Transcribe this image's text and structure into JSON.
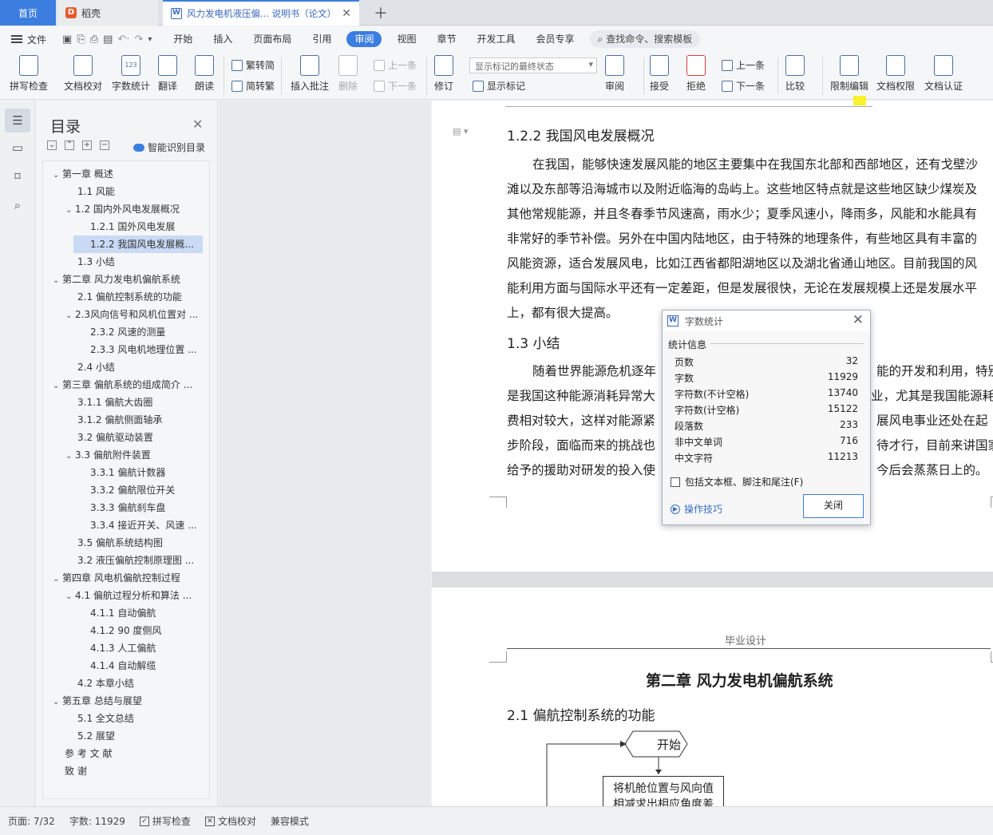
{
  "tabs": {
    "home": "首页",
    "daoke": "稻壳",
    "doc": "风力发电机液压偏... 说明书（论文）"
  },
  "menubar": {
    "file": "文件",
    "items": [
      "开始",
      "插入",
      "页面布局",
      "引用",
      "审阅",
      "视图",
      "章节",
      "开发工具",
      "会员专享"
    ],
    "active": "审阅",
    "search": "查找命令、搜索模板"
  },
  "ribbon": {
    "spell": "拼写检查",
    "proof": "文档校对",
    "wordcount": "字数统计",
    "translate": "翻译",
    "read": "朗读",
    "to_trad": "繁转简",
    "to_simp": "简转繁",
    "insert_comment": "插入批注",
    "delete": "删除",
    "prev": "上一条",
    "next": "下一条",
    "revise": "修订",
    "markup_state": "显示标记的最终状态",
    "show_markup": "显示标记",
    "review": "审阅",
    "accept": "接受",
    "reject": "拒绝",
    "prev2": "上一条",
    "next2": "下一条",
    "compare": "比较",
    "restrict": "限制编辑",
    "rights": "文档权限",
    "certify": "文档认证"
  },
  "toc": {
    "title": "目录",
    "smart": "智能识别目录",
    "items": [
      "第一章  概述",
      "1.1  风能",
      "1.2  国内外风电发展概况",
      "1.2.1  国外风电发展",
      "1.2.2  我国风电发展概...",
      "1.3  小结",
      "第二章  风力发电机偏航系统",
      "2.1 偏航控制系统的功能",
      "2.3风向信号和风机位置对 ...",
      "2.3.2 风速的测量",
      "2.3.3  风电机地理位置 ...",
      "2.4 小结",
      "第三章  偏航系统的组成简介 ...",
      "3.1.1 偏航大齿圈",
      "3.1.2 偏航侧面轴承",
      "3.2 偏航驱动装置",
      "3.3 偏航附件装置",
      "3.3.1 偏航计数器",
      "3.3.2 偏航限位开关",
      "3.3.3 偏航刹车盘",
      "3.3.4 接近开关、风速 ...",
      "3.5  偏航系统结构图",
      "3.2 液压偏航控制原理图 ...",
      "第四章  风电机偏航控制过程",
      "4.1 偏航过程分析和算法 ...",
      "4.1.1 自动偏航",
      "4.1.2 90 度侧风",
      "4.1.3 人工偏航",
      "4.1.4 自动解缆",
      "4.2 本章小结",
      "第五章  总结与展望",
      "5.1  全文总结",
      "5.2  展望",
      "参 考 文 献",
      "致  谢"
    ]
  },
  "page1": {
    "heading_122": "1.2.2  我国风电发展概况",
    "para1": [
      "在我国，能够快速发展风能的地区主要集中在我国东北部和西部地区，还有戈壁沙",
      "滩以及东部等沿海城市以及附近临海的岛屿上。这些地区特点就是这些地区缺少煤炭及",
      "其他常规能源，并且冬春季节风速高，雨水少；夏季风速小，降雨多，风能和水能具有",
      "非常好的季节补偿。另外在中国内陆地区，由于特殊的地理条件，有些地区具有丰富的",
      "风能资源，适合发展风电，比如江西省都阳湖地区以及湖北省通山地区。目前我国的风",
      "能利用方面与国际水平还有一定差距，但是发展很快，无论在发展规模上还是发展水平",
      "上，都有很大提高。"
    ],
    "heading_13": "1.3  小结",
    "para2_left": [
      "随着世界能源危机逐年",
      "是我国这种能源消耗异常大",
      "费相对较大，这样对能源紧",
      "步阶段，面临而来的挑战也",
      "给予的援助对研发的投入使"
    ],
    "para2_right": [
      "能的开发和利用，特别",
      "业，尤其是我国能源耗",
      "展风电事业还处在起",
      "待才行，目前来讲国家",
      "今后会蒸蒸日上的。"
    ]
  },
  "page2": {
    "header": "毕业设计",
    "chapter": "第二章  风力发电机偏航系统",
    "section": "2.1 偏航控制系统的功能",
    "flow_start": "开始",
    "flow_box": "将机舱位置与风向值",
    "flow_box2": "相减求出相应角度差"
  },
  "dialog": {
    "title": "字数统计",
    "group": "统计信息",
    "stats": [
      {
        "label": "页数",
        "value": "32"
      },
      {
        "label": "字数",
        "value": "11929"
      },
      {
        "label": "字符数(不计空格)",
        "value": "13740"
      },
      {
        "label": "字符数(计空格)",
        "value": "15122"
      },
      {
        "label": "段落数",
        "value": "233"
      },
      {
        "label": "非中文单词",
        "value": "716"
      },
      {
        "label": "中文字符",
        "value": "11213"
      }
    ],
    "checkbox": "包括文本框、脚注和尾注(F)",
    "tips": "操作技巧",
    "close_btn": "关闭"
  },
  "status": {
    "page": "页面: 7/32",
    "words": "字数: 11929",
    "spell": "拼写检查",
    "proof": "文档校对",
    "compat": "兼容模式"
  },
  "colors": {
    "accent": "#3b7ee0",
    "highlight": "#f9f12a"
  }
}
